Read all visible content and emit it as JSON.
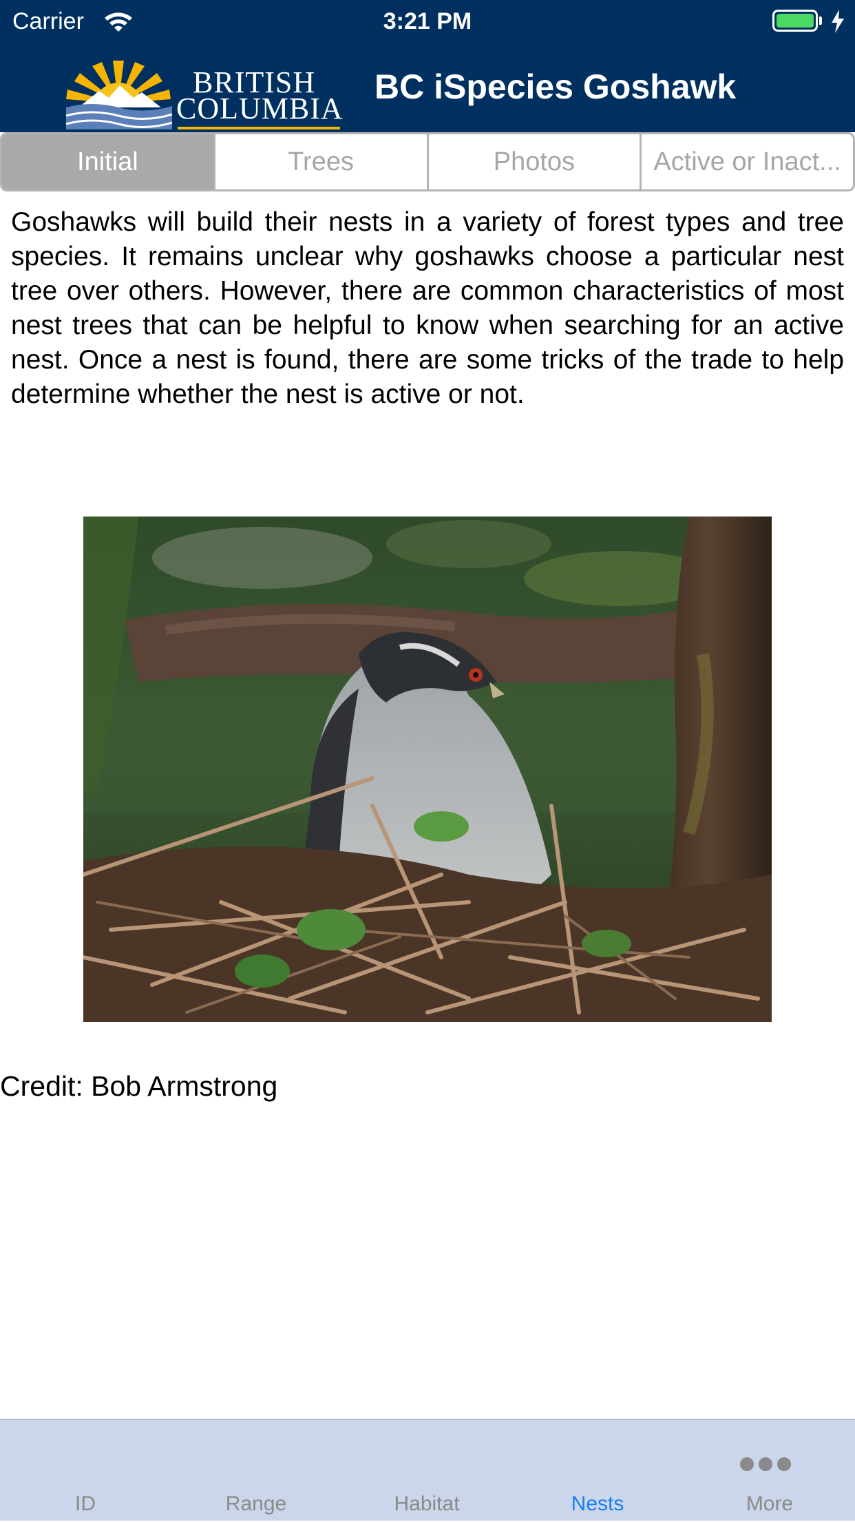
{
  "status_bar": {
    "carrier": "Carrier",
    "time": "3:21 PM",
    "battery_color": "#4cd964"
  },
  "nav": {
    "logo_line1": "BRITISH",
    "logo_line2": "COLUMBIA",
    "title": "BC iSpecies Goshawk",
    "background_color": "#00305f"
  },
  "segments": {
    "selected": "Initial",
    "items": [
      {
        "label": "Initial"
      },
      {
        "label": "Trees"
      },
      {
        "label": "Photos"
      },
      {
        "label": "Active or Inact..."
      }
    ]
  },
  "content": {
    "intro": "Goshawks will build their nests in a variety of forest types and tree species. It remains unclear why goshawks choose a particular nest tree over others. However, there are common characteristics of most nest trees that can be helpful to know when searching for an active nest. Once a nest is found, there are some tricks of the trade to help determine whether the nest is active or not.",
    "photo_icon": "goshawk-on-nest-photo",
    "credit": "Credit: Bob Armstrong"
  },
  "tab_bar": {
    "active": "Nests",
    "active_color": "#1a7df5",
    "items": [
      {
        "label": "ID"
      },
      {
        "label": "Range"
      },
      {
        "label": "Habitat"
      },
      {
        "label": "Nests"
      },
      {
        "label": "More",
        "icon": "ellipsis-icon"
      }
    ]
  }
}
